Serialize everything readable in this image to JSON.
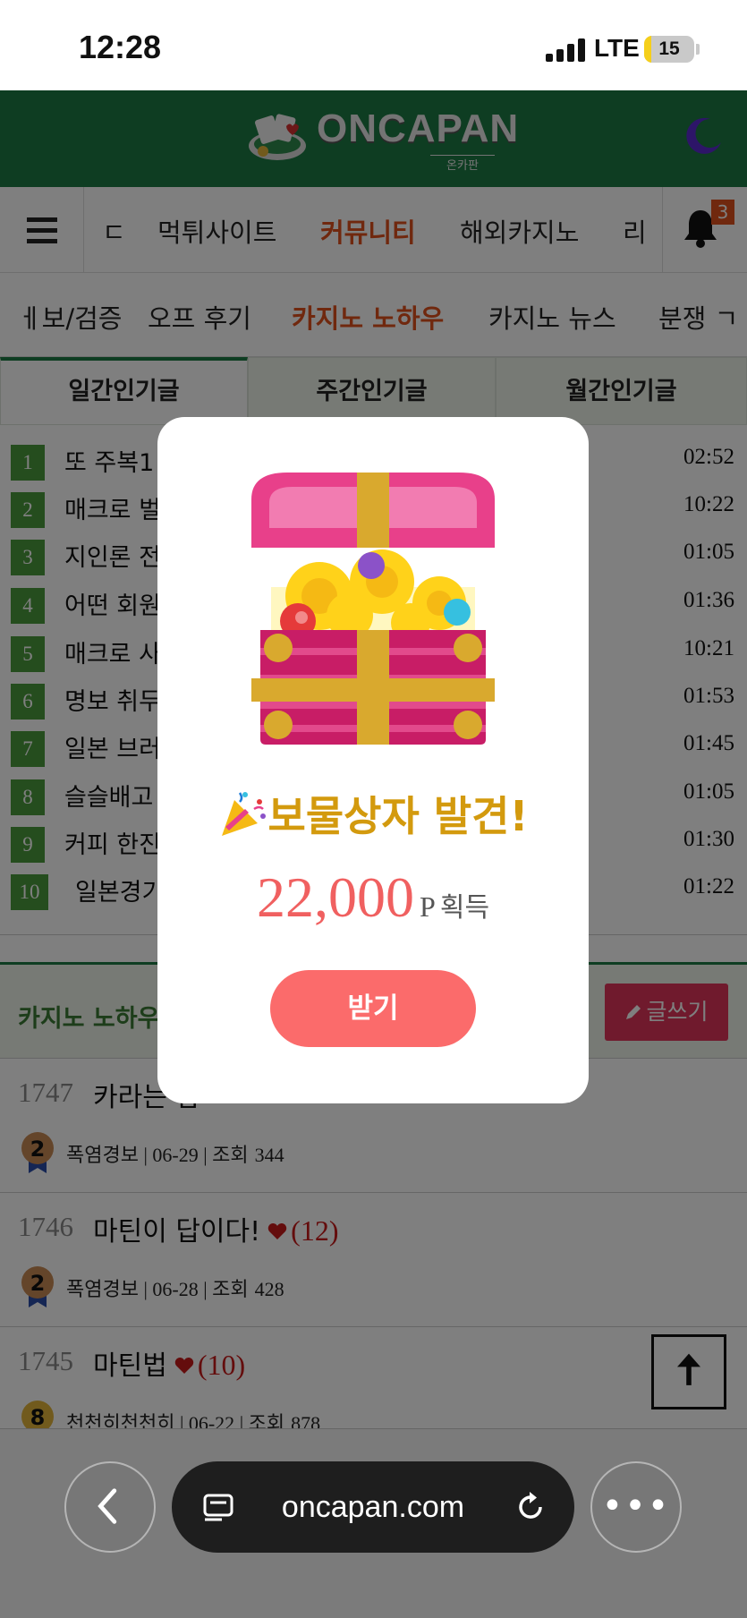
{
  "status_bar": {
    "time": "12:28",
    "network": "LTE",
    "battery": "15",
    "battery_level_percent": 15
  },
  "header": {
    "logo_text": "ONCAPAN",
    "logo_subtext": "온카판"
  },
  "main_nav": {
    "items": [
      {
        "label": "ㄷ",
        "active": false
      },
      {
        "label": "먹튀사이트",
        "active": false
      },
      {
        "label": "커뮤니티",
        "active": true
      },
      {
        "label": "해외카지노",
        "active": false
      },
      {
        "label": "리",
        "active": false
      }
    ],
    "notification_count": "3"
  },
  "sub_nav": {
    "items": [
      {
        "label": "ㅔ보/검증",
        "active": false
      },
      {
        "label": "오프 후기",
        "active": false
      },
      {
        "label": "카지노 노하우",
        "active": true
      },
      {
        "label": "카지노 뉴스",
        "active": false
      },
      {
        "label": "분쟁 ㄱ",
        "active": false
      }
    ]
  },
  "popular": {
    "tabs": [
      {
        "label": "일간인기글",
        "active": true
      },
      {
        "label": "주간인기글",
        "active": false
      },
      {
        "label": "월간인기글",
        "active": false
      }
    ],
    "rows": [
      {
        "rank": "1",
        "title": "또 주복1",
        "time": "02:52"
      },
      {
        "rank": "2",
        "title": "매크로 벌",
        "time": "10:22"
      },
      {
        "rank": "3",
        "title": "지인론 전",
        "time": "01:05"
      },
      {
        "rank": "4",
        "title": "어떤 회원",
        "time": "01:36"
      },
      {
        "rank": "5",
        "title": "매크로 사",
        "time": "10:21"
      },
      {
        "rank": "6",
        "title": "명보 취두",
        "time": "01:53"
      },
      {
        "rank": "7",
        "title": "일본 브러",
        "time": "01:45"
      },
      {
        "rank": "8",
        "title": "슬슬배고",
        "time": "01:05"
      },
      {
        "rank": "9",
        "title": "커피 한진",
        "time": "01:30"
      },
      {
        "rank": "10",
        "title": "일본경기",
        "time": "01:22"
      }
    ]
  },
  "board": {
    "title": "카지노 노하우",
    "write_label": "글쓰기",
    "posts": [
      {
        "num": "1747",
        "title": "카라는 랍",
        "count": "",
        "level": "2",
        "author": "폭염경보",
        "date": "06-29",
        "views_label": "조회",
        "views": "344"
      },
      {
        "num": "1746",
        "title": "마틴이 답이다!",
        "count": "(12)",
        "level": "2",
        "author": "폭염경보",
        "date": "06-28",
        "views_label": "조회",
        "views": "428"
      },
      {
        "num": "1745",
        "title": "마틴법",
        "count": "(10)",
        "level": "8",
        "author": "천천히천천히",
        "date": "06-22",
        "views_label": "조회",
        "views": "878"
      }
    ]
  },
  "modal": {
    "title": "보물상자 발견!",
    "amount": "22,000",
    "unit": "P",
    "reward_text": "획득",
    "button_label": "받기"
  },
  "browser": {
    "url": "oncapan.com"
  },
  "colors": {
    "brand_green": "#1d7a44",
    "accent_orange": "#e0501d",
    "rank_green": "#4a9a3c",
    "modal_button": "#fb6b6b",
    "modal_title": "#d39a0e",
    "write_button": "#e0355a"
  }
}
